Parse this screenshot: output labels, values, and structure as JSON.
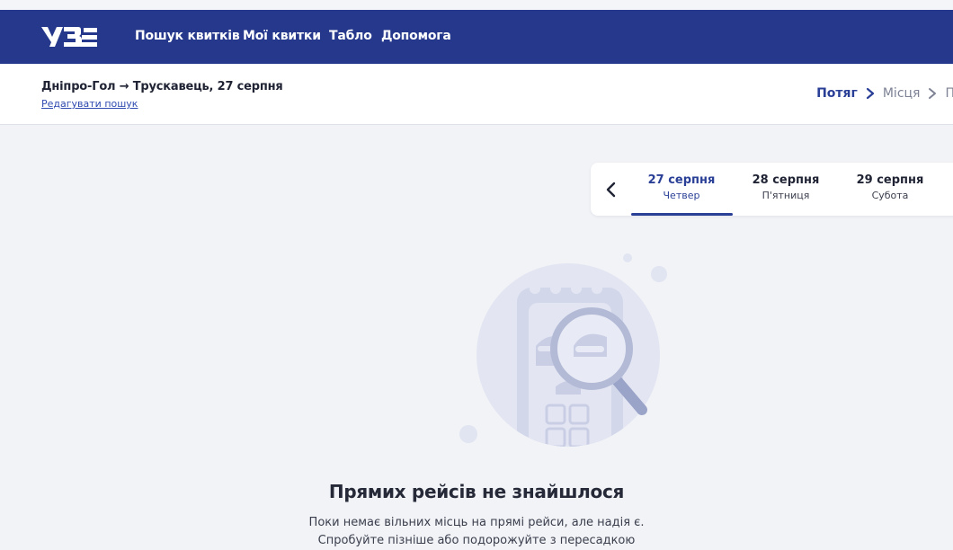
{
  "brand": {
    "logo_text": "УЗ",
    "accent": "#25388b"
  },
  "nav": {
    "items": [
      {
        "label": "Пошук квитків"
      },
      {
        "label": "Мої квитки"
      },
      {
        "label": "Табло"
      },
      {
        "label": "Допомога"
      }
    ]
  },
  "search": {
    "route": "Дніпро-Гол → Трускавець, 27 серпня",
    "edit_label": "Редагувати пошук"
  },
  "steps": [
    {
      "label": "Потяг",
      "state": "active"
    },
    {
      "label": "Місця",
      "state": "inactive"
    },
    {
      "label": "П",
      "state": "inactive"
    }
  ],
  "dates": {
    "prev_icon": "chevron-left-icon",
    "tabs": [
      {
        "date": "27 серпня",
        "day": "Четвер",
        "active": true
      },
      {
        "date": "28 серпня",
        "day": "П'ятниця",
        "active": false
      },
      {
        "date": "29 серпня",
        "day": "Субота",
        "active": false
      }
    ]
  },
  "empty_state": {
    "icon": "ticket-search-icon",
    "title": "Прямих рейсів не знайшлося",
    "line1": "Поки немає вільних місць на прямі рейси, але надія є.",
    "line2": "Спробуйте пізніше або подорожуйте з пересадкою"
  }
}
